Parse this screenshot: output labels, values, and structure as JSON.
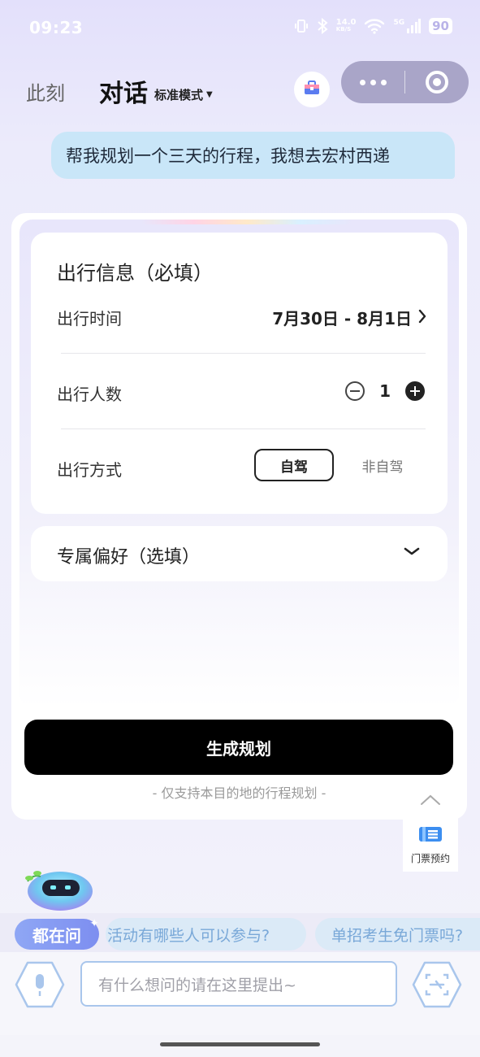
{
  "status_bar": {
    "time": "09:23",
    "net_speed": "14.0",
    "net_unit": "KB/S",
    "signal": "5G",
    "battery": "90"
  },
  "header": {
    "tab_now": "此刻",
    "title": "对话",
    "mode": "标准模式"
  },
  "chat": {
    "user_message": "帮我规划一个三天的行程，我想去宏村西递"
  },
  "form": {
    "info_title": "出行信息（必填）",
    "time_label": "出行时间",
    "time_value": "7月30日 - 8月1日",
    "people_label": "出行人数",
    "people_count": "1",
    "mode_label": "出行方式",
    "mode_options": [
      "自驾",
      "非自驾"
    ],
    "mode_selected": "自驾",
    "pref_title": "专属偏好（选填）",
    "generate_button": "生成规划",
    "note": "- 仅支持本目的地的行程规划 -"
  },
  "float": {
    "ticket_label": "门票预约"
  },
  "suggestions": {
    "badge": "都在问",
    "items": [
      "活动有哪些人可以参与?",
      "单招考生免门票吗?"
    ]
  },
  "input": {
    "placeholder": "有什么想问的请在这里提出~"
  },
  "colors": {
    "accent_blue": "#7d8ef0",
    "bubble_bg": "#c9e6f8",
    "primary_button": "#000000"
  }
}
